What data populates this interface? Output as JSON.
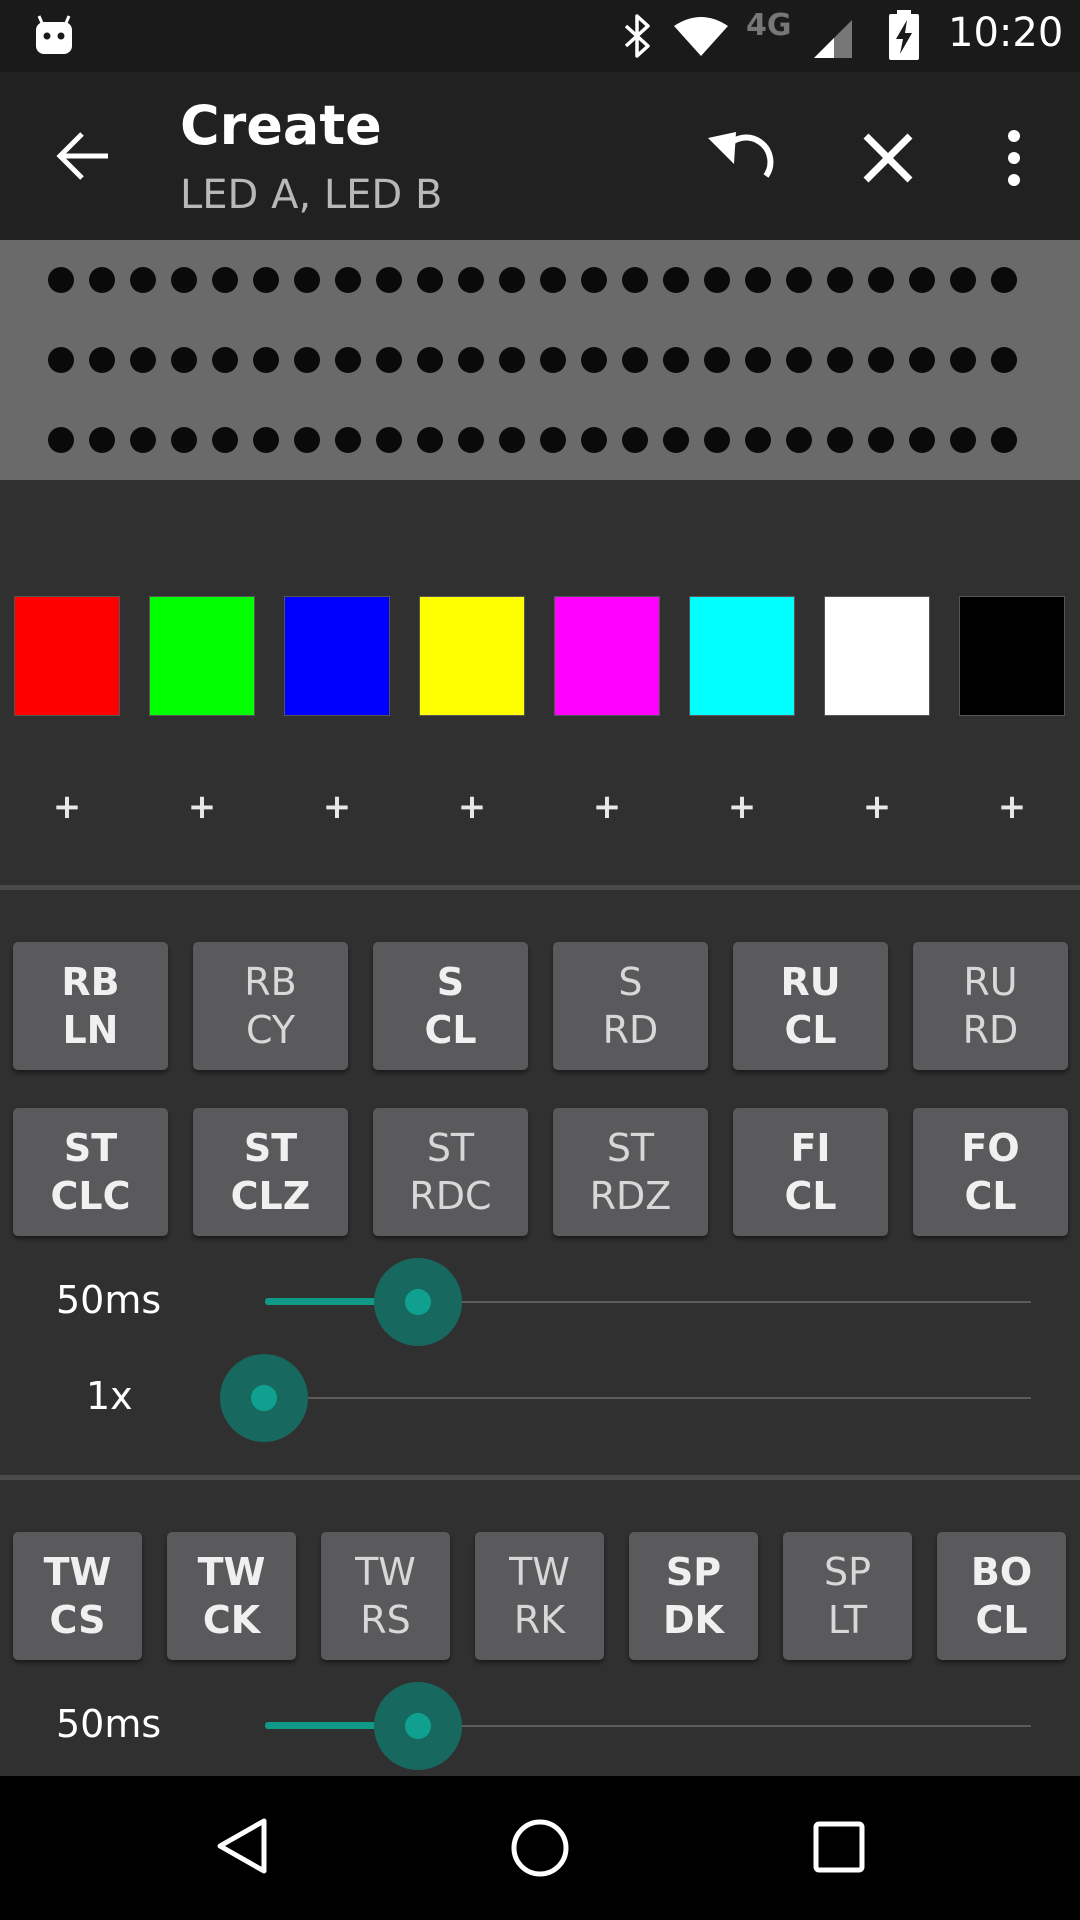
{
  "status_bar": {
    "network": "4G",
    "time": "10:20",
    "icons": [
      "android-icon",
      "bluetooth-icon",
      "wifi-icon",
      "cell-signal-icon",
      "battery-charging-icon"
    ]
  },
  "app_bar": {
    "title": "Create",
    "subtitle": "LED A, LED B",
    "actions": [
      "back-arrow-icon",
      "undo-icon",
      "close-icon",
      "more-vert-icon"
    ]
  },
  "led_preview": {
    "rows": 3,
    "leds_per_row": 24,
    "led_color": "#0a0a0a",
    "background": "#6a6a6a"
  },
  "colors": {
    "swatches": [
      "#ff0000",
      "#00ff00",
      "#0000ff",
      "#ffff00",
      "#ff00ff",
      "#00ffff",
      "#ffffff",
      "#000000"
    ],
    "add_label": "+"
  },
  "effects_group1": {
    "buttons": [
      {
        "label": "RB\nLN",
        "enabled": true
      },
      {
        "label": "RB\nCY",
        "enabled": false
      },
      {
        "label": "S\nCL",
        "enabled": true
      },
      {
        "label": "S\nRD",
        "enabled": false
      },
      {
        "label": "RU\nCL",
        "enabled": true
      },
      {
        "label": "RU\nRD",
        "enabled": false
      },
      {
        "label": "ST\nCLC",
        "enabled": true
      },
      {
        "label": "ST\nCLZ",
        "enabled": true
      },
      {
        "label": "ST\nRDC",
        "enabled": false
      },
      {
        "label": "ST\nRDZ",
        "enabled": false
      },
      {
        "label": "FI\nCL",
        "enabled": true
      },
      {
        "label": "FO\nCL",
        "enabled": true
      }
    ],
    "speed": {
      "label": "50ms",
      "value_fraction": 0.19
    },
    "repeat": {
      "label": "1x",
      "value_fraction": 0.0
    }
  },
  "effects_group2": {
    "buttons": [
      {
        "label": "TW\nCS",
        "enabled": true
      },
      {
        "label": "TW\nCK",
        "enabled": true
      },
      {
        "label": "TW\nRS",
        "enabled": false
      },
      {
        "label": "TW\nRK",
        "enabled": false
      },
      {
        "label": "SP\nDK",
        "enabled": true
      },
      {
        "label": "SP\nLT",
        "enabled": false
      },
      {
        "label": "BO\nCL",
        "enabled": true
      }
    ],
    "speed": {
      "label": "50ms",
      "value_fraction": 0.19
    }
  },
  "nav_bar": {
    "icons": [
      "back-triangle-icon",
      "home-circle-icon",
      "recents-square-icon"
    ]
  },
  "accent_color": "#0f9a88"
}
